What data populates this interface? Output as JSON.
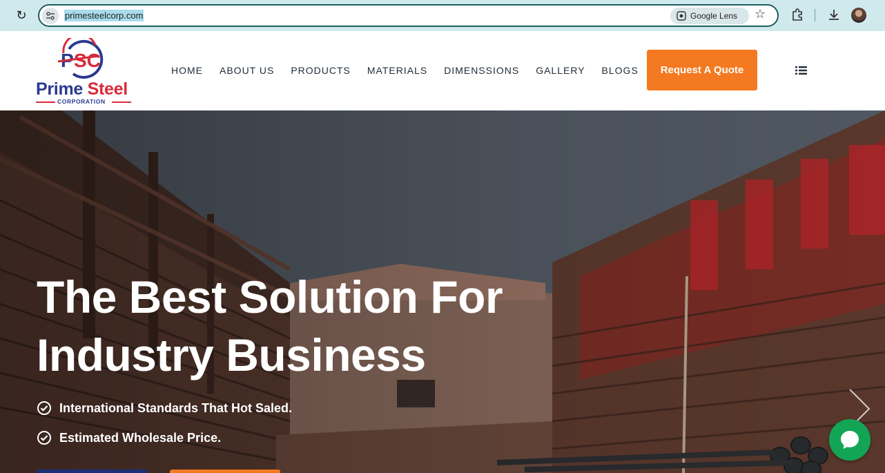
{
  "browser": {
    "url": "primesteelcorp.com",
    "lens_label": "Google Lens",
    "icons": [
      "reload-icon",
      "site-info-icon",
      "google-lens-icon",
      "star-icon",
      "extensions-icon",
      "download-icon",
      "profile-avatar",
      "more-icon"
    ]
  },
  "header": {
    "logo": {
      "mark": "PSC",
      "name_part1": "Prime ",
      "name_part2": "Steel",
      "sub": "CORPORATION"
    },
    "nav": [
      "HOME",
      "ABOUT US",
      "PRODUCTS",
      "MATERIALS",
      "DIMENSSIONS",
      "GALLERY",
      "BLOGS"
    ],
    "quote_button": "Request A Quote",
    "menu_icon": "list-menu-icon"
  },
  "hero": {
    "title_line1": "The Best Solution For",
    "title_line2": "Industry Business",
    "features": [
      "International Standards That Hot Saled.",
      "Estimated Wholesale Price."
    ],
    "colors": {
      "accent": "#f47920",
      "brand_blue": "#2a3a8f",
      "brand_red": "#d92b3a",
      "chat_green": "#13a556"
    }
  }
}
